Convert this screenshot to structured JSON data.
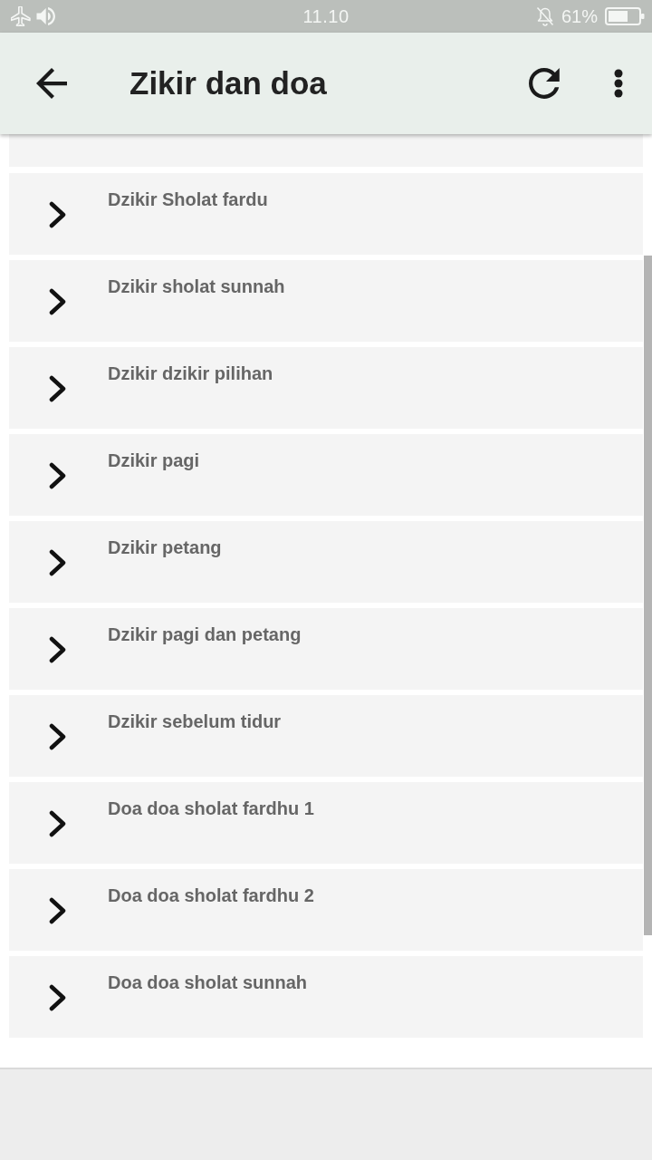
{
  "status_bar": {
    "time": "11.10",
    "battery": "61%"
  },
  "app_bar": {
    "title": "Zikir dan doa"
  },
  "items": [
    {
      "label": "Dzikir Sholat fardu"
    },
    {
      "label": "Dzikir sholat sunnah"
    },
    {
      "label": "Dzikir dzikir pilihan"
    },
    {
      "label": "Dzikir pagi"
    },
    {
      "label": "Dzikir petang"
    },
    {
      "label": "Dzikir pagi dan petang"
    },
    {
      "label": "Dzikir sebelum tidur"
    },
    {
      "label": "Doa doa sholat fardhu 1"
    },
    {
      "label": "Doa doa sholat fardhu 2"
    },
    {
      "label": "Doa doa sholat sunnah"
    }
  ]
}
